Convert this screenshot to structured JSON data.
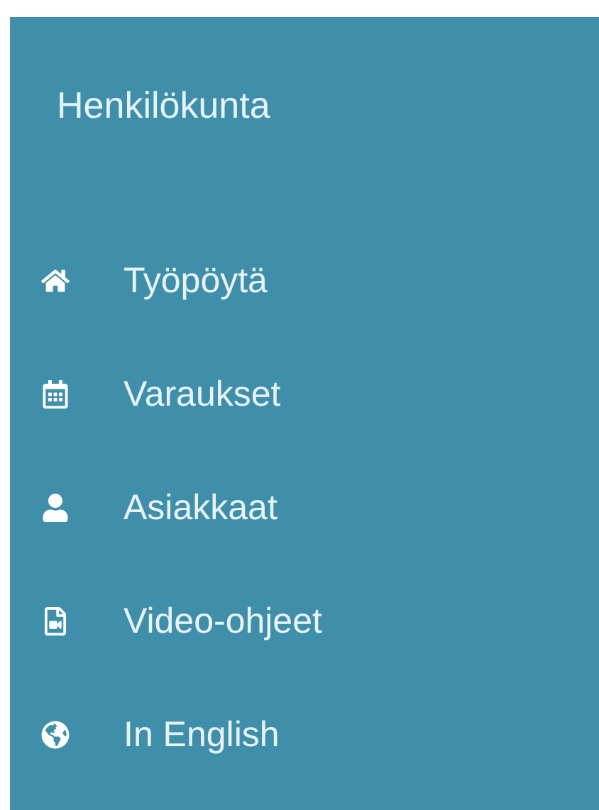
{
  "sidebar": {
    "title": "Henkilökunta",
    "items": [
      {
        "label": "Työpöytä"
      },
      {
        "label": "Varaukset"
      },
      {
        "label": "Asiakkaat"
      },
      {
        "label": "Video-ohjeet"
      },
      {
        "label": "In English"
      }
    ]
  }
}
